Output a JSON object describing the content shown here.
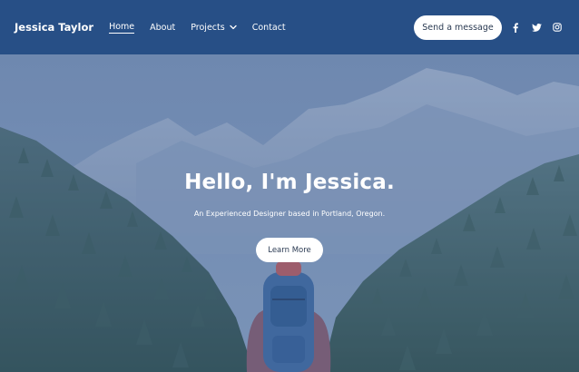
{
  "nav": {
    "brand": "Jessica Taylor",
    "links": [
      {
        "label": "Home"
      },
      {
        "label": "About"
      },
      {
        "label": "Projects"
      },
      {
        "label": "Contact"
      }
    ],
    "cta_label": "Send a message",
    "social": [
      "facebook-icon",
      "twitter-icon",
      "instagram-icon"
    ]
  },
  "hero": {
    "title": "Hello, I'm Jessica.",
    "subtitle": "An Experienced Designer based in Portland, Oregon.",
    "button_label": "Learn More"
  },
  "colors": {
    "navbar": "#274f86",
    "overlay": "#4664a0",
    "button_bg": "#ffffff",
    "button_text": "#2a3a52"
  }
}
